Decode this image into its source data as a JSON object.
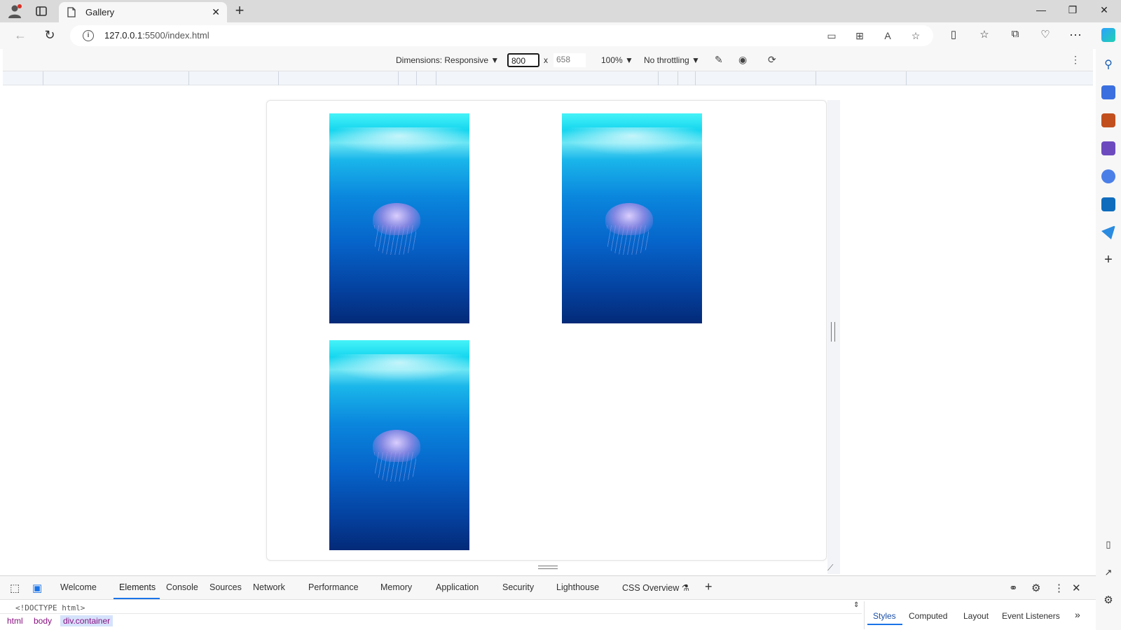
{
  "browser": {
    "tab_title": "Gallery",
    "url_host": "127.0.0.1",
    "url_rest": ":5500/index.html"
  },
  "device_toolbar": {
    "dimensions_label": "Dimensions: Responsive",
    "width": "800",
    "times": "x",
    "height": "658",
    "zoom": "100%",
    "throttling": "No throttling"
  },
  "gallery": {
    "images": [
      {
        "alt": "jellyfish"
      },
      {
        "alt": "jellyfish"
      },
      {
        "alt": "jellyfish"
      }
    ]
  },
  "devtools": {
    "tabs": [
      "Welcome",
      "Elements",
      "Console",
      "Sources",
      "Network",
      "Performance",
      "Memory",
      "Application",
      "Security",
      "Lighthouse",
      "CSS Overview"
    ],
    "active_tab": "Elements",
    "doctype": "<!DOCTYPE html>",
    "breadcrumbs": [
      "html",
      "body",
      "div.container"
    ],
    "side_tabs": [
      "Styles",
      "Computed",
      "Layout",
      "Event Listeners"
    ],
    "active_side_tab": "Styles"
  },
  "colors": {
    "accent": "#1a73e8",
    "breadcrumb_tag": "#881280",
    "breadcrumb_selected_bg": "#d6e2fb"
  }
}
